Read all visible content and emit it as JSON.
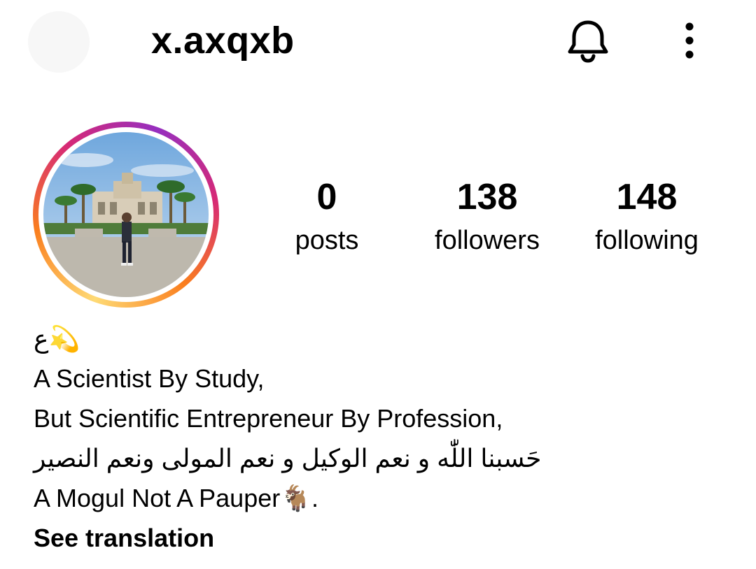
{
  "header": {
    "username": "x.axqxb",
    "bell_icon": "bell-icon",
    "more_icon": "more-vertical-icon"
  },
  "profile": {
    "avatar_ring_colors": [
      "#feda75",
      "#fa7e1e",
      "#d62976",
      "#962fbf"
    ],
    "stats": [
      {
        "value": "0",
        "label": "posts"
      },
      {
        "value": "138",
        "label": "followers"
      },
      {
        "value": "148",
        "label": "following"
      }
    ]
  },
  "bio": {
    "line1": "ع💫",
    "line2": "A Scientist By Study,",
    "line3": "But Scientific Entrepreneur By Profession,",
    "line4": "حَسبنا اللّٰه و نعم الوكيل و نعم المولى ونعم النصير",
    "line5": "A Mogul Not A Pauper🐐.",
    "see_translation": "See translation"
  }
}
